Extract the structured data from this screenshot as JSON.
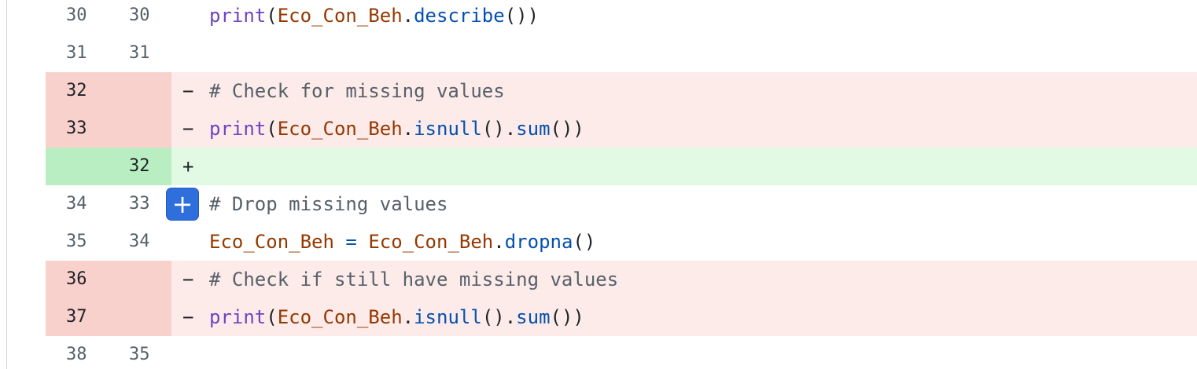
{
  "diff": {
    "rows": [
      {
        "type": "ctx",
        "old": "30",
        "new": "30",
        "marker": "",
        "code": [
          {
            "t": "print",
            "c": "builtin"
          },
          {
            "t": "(",
            "c": "punct"
          },
          {
            "t": "Eco_Con_Beh",
            "c": "var"
          },
          {
            "t": ".",
            "c": "punct"
          },
          {
            "t": "describe",
            "c": "method"
          },
          {
            "t": "())",
            "c": "punct"
          }
        ]
      },
      {
        "type": "ctx",
        "old": "31",
        "new": "31",
        "marker": "",
        "code": []
      },
      {
        "type": "del",
        "old": "32",
        "new": "",
        "marker": "-",
        "code": [
          {
            "t": "# Check for missing values",
            "c": "comment"
          }
        ]
      },
      {
        "type": "del",
        "old": "33",
        "new": "",
        "marker": "-",
        "code": [
          {
            "t": "print",
            "c": "builtin"
          },
          {
            "t": "(",
            "c": "punct"
          },
          {
            "t": "Eco_Con_Beh",
            "c": "var"
          },
          {
            "t": ".",
            "c": "punct"
          },
          {
            "t": "isnull",
            "c": "method"
          },
          {
            "t": "().",
            "c": "punct"
          },
          {
            "t": "sum",
            "c": "method"
          },
          {
            "t": "())",
            "c": "punct"
          }
        ]
      },
      {
        "type": "add",
        "old": "",
        "new": "32",
        "marker": "+",
        "code": []
      },
      {
        "type": "ctx",
        "old": "34",
        "new": "33",
        "marker": "",
        "hover": true,
        "code": [
          {
            "t": "# Drop missing values",
            "c": "comment"
          }
        ]
      },
      {
        "type": "ctx",
        "old": "35",
        "new": "34",
        "marker": "",
        "code": [
          {
            "t": "Eco_Con_Beh",
            "c": "var"
          },
          {
            "t": " = ",
            "c": "op"
          },
          {
            "t": "Eco_Con_Beh",
            "c": "var"
          },
          {
            "t": ".",
            "c": "punct"
          },
          {
            "t": "dropna",
            "c": "method"
          },
          {
            "t": "()",
            "c": "punct"
          }
        ]
      },
      {
        "type": "del",
        "old": "36",
        "new": "",
        "marker": "-",
        "code": [
          {
            "t": "# Check if still have missing values",
            "c": "comment"
          }
        ]
      },
      {
        "type": "del",
        "old": "37",
        "new": "",
        "marker": "-",
        "code": [
          {
            "t": "print",
            "c": "builtin"
          },
          {
            "t": "(",
            "c": "punct"
          },
          {
            "t": "Eco_Con_Beh",
            "c": "var"
          },
          {
            "t": ".",
            "c": "punct"
          },
          {
            "t": "isnull",
            "c": "method"
          },
          {
            "t": "().",
            "c": "punct"
          },
          {
            "t": "sum",
            "c": "method"
          },
          {
            "t": "())",
            "c": "punct"
          }
        ]
      },
      {
        "type": "ctx",
        "old": "38",
        "new": "35",
        "marker": "",
        "code": []
      }
    ],
    "add_comment_icon": "plus-icon"
  },
  "colors": {
    "deleted_gutter": "#f8d0cc",
    "deleted_line": "#fcebe9",
    "added_gutter": "#b9eec2",
    "added_line": "#e2f9e3",
    "add_comment_button": "#2f6fdb"
  }
}
